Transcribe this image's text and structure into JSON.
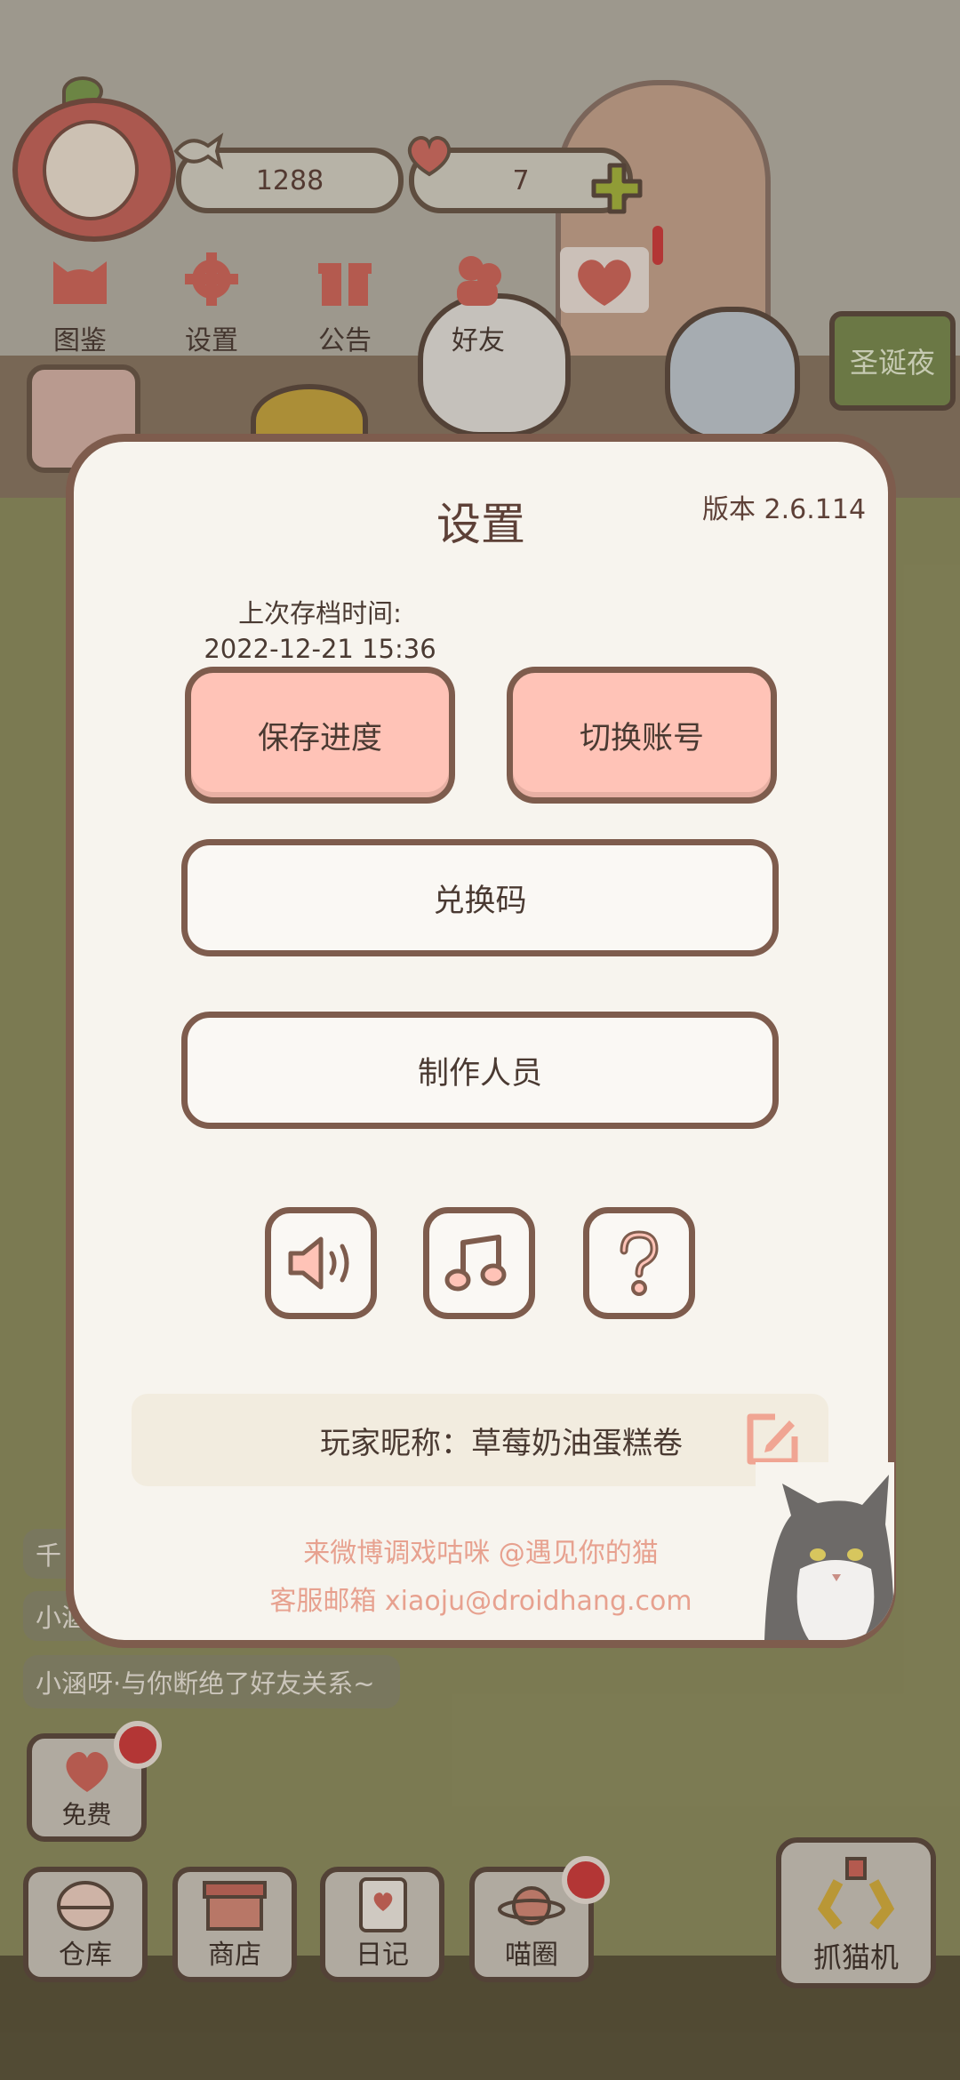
{
  "hud": {
    "fish_count": "1288",
    "heart_count": "7",
    "plus_icon": "plus-icon"
  },
  "top_nav": [
    {
      "label": "图鉴",
      "icon": "cat-head-icon"
    },
    {
      "label": "设置",
      "icon": "gear-icon"
    },
    {
      "label": "公告",
      "icon": "gift-icon"
    },
    {
      "label": "好友",
      "icon": "friends-icon"
    }
  ],
  "event_button": {
    "label": "圣诞夜"
  },
  "settings": {
    "title": "设置",
    "version": "版本 2.6.114",
    "last_save_label": "上次存档时间:",
    "last_save_time": "2022-12-21 15:36",
    "save_button": "保存进度",
    "switch_account_button": "切换账号",
    "redeem_code_button": "兑换码",
    "credits_button": "制作人员",
    "icons": [
      "speaker-icon",
      "music-icon",
      "help-icon"
    ],
    "nickname": "玩家昵称：草莓奶油蛋糕卷",
    "weibo": "来微博调戏咕咪 @遇见你的猫",
    "email": "客服邮箱 xiaoju@droidhang.com"
  },
  "chat": {
    "messages": [
      "千",
      "小涵",
      "小涵呀·与你断绝了好友关系~"
    ]
  },
  "free_button": {
    "label": "免费"
  },
  "bottom_bar": [
    {
      "label": "仓库",
      "icon": "bowl-icon",
      "badge": false
    },
    {
      "label": "商店",
      "icon": "shop-icon",
      "badge": false
    },
    {
      "label": "日记",
      "icon": "diary-icon",
      "badge": false
    },
    {
      "label": "喵圈",
      "icon": "cat-planet-icon",
      "badge": true
    }
  ],
  "claw_machine": {
    "label": "抓猫机"
  },
  "colors": {
    "accent_pink": "#ffc3b7",
    "border_brown": "#7e5c4d",
    "link_salmon": "#e7a18f",
    "badge_red": "#d23b3b"
  }
}
